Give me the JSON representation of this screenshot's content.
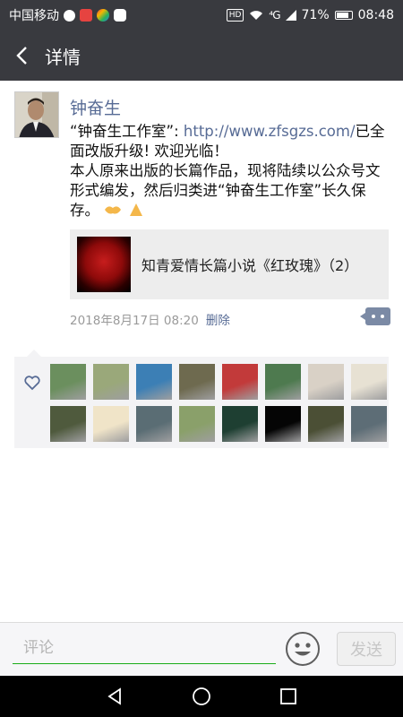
{
  "status_bar": {
    "carrier": "中国移动",
    "hd": "HD",
    "signal": "⁴G",
    "battery": "71%",
    "time": "08:48"
  },
  "header": {
    "title": "详情"
  },
  "post": {
    "author": "钟奋生",
    "text_prefix": "“钟奋生工作室”: ",
    "link": "http://www.zfsgzs.com/",
    "text_suffix": "已全面改版升级! 欢迎光临！",
    "text_body": "本人原来出版的长篇作品，现将陆续以公众号文形式编发，然后归类进“钟奋生工作室”长久保存。",
    "shared_title": "知青爱情长篇小说《红玫瑰》（2）",
    "timestamp": "2018年8月17日 08:20",
    "delete_label": "删除"
  },
  "likes": {
    "avatars": [
      "#6b8f5e",
      "#9aa87a",
      "#3c7fb5",
      "#6e6a4f",
      "#c23a3a",
      "#4e7a4f",
      "#d9d1c6",
      "#e7e1d3",
      "#4f5a3d",
      "#f0e4c8",
      "#5a6d74",
      "#8aa06a",
      "#1e3f32",
      "#050505",
      "#4b4f35",
      "#5d6d76"
    ]
  },
  "input": {
    "placeholder": "评论",
    "send_label": "发送"
  }
}
